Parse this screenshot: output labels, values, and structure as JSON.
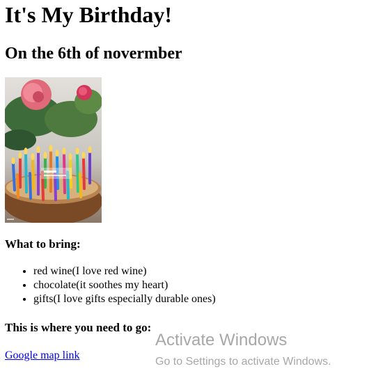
{
  "page": {
    "title": "It's My Birthday!",
    "subtitle": "On the 6th of novermber"
  },
  "photo": {
    "alt_icon": "birthday-cake-photo"
  },
  "bring": {
    "heading": "What to bring:",
    "items": [
      "red wine(I love red wine)",
      "chocolate(it soothes my heart)",
      "gifts(I love gifts especially durable ones)"
    ]
  },
  "location": {
    "heading": "This is where you need to go:",
    "link_text": "Google map link"
  },
  "watermark": {
    "title": "Activate Windows",
    "subtitle": "Go to Settings to activate Windows."
  },
  "colors": {
    "link": "#0000ee",
    "text": "#000000",
    "background": "#ffffff"
  }
}
